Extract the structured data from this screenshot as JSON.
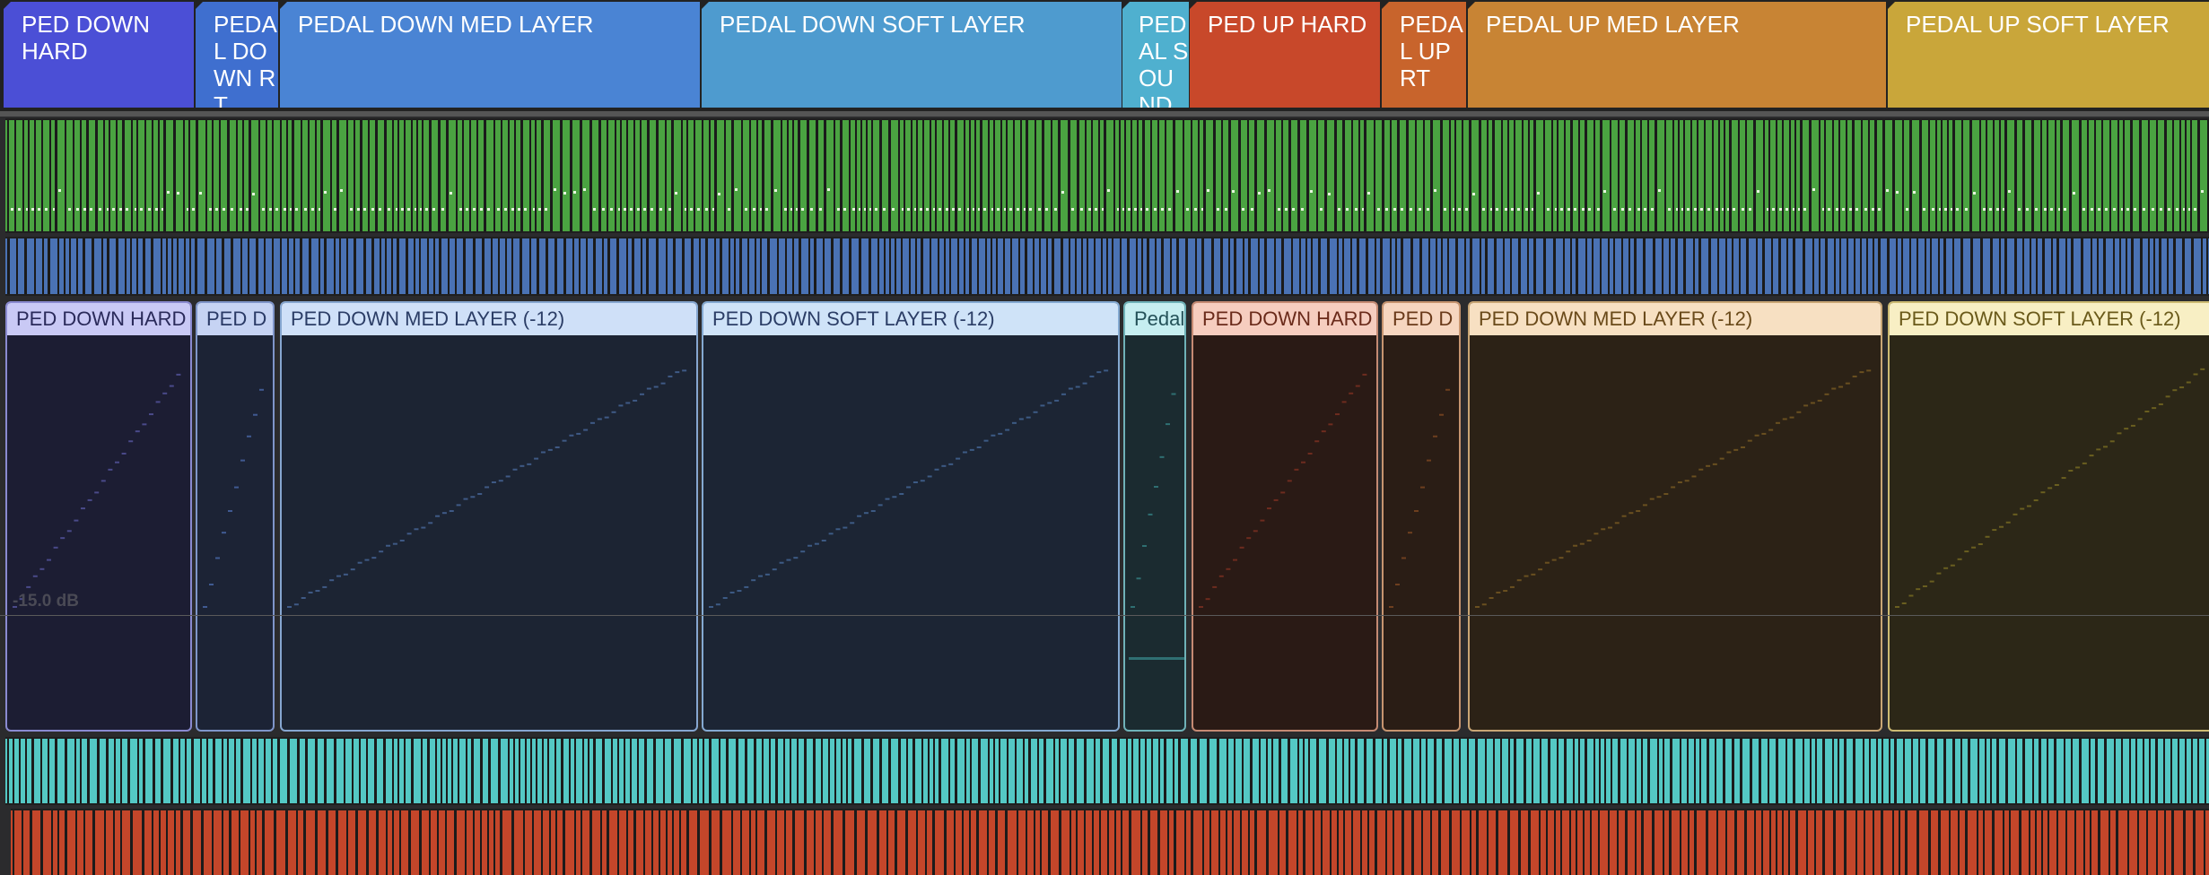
{
  "markers": [
    {
      "label": "PED DOWN HARD",
      "color": "#4b4fd6"
    },
    {
      "label": "PEDAL DOWN RT",
      "color": "#3f6fcf"
    },
    {
      "label": "PEDAL DOWN MED LAYER",
      "color": "#4a84d4"
    },
    {
      "label": "PEDAL DOWN SOFT LAYER",
      "color": "#4e9bcf"
    },
    {
      "label": "PEDAL SOUND",
      "color": "#4fb0cf"
    },
    {
      "label": "PED UP HARD",
      "color": "#c8482a"
    },
    {
      "label": "PEDAL UP RT",
      "color": "#c8642c"
    },
    {
      "label": "PEDAL UP MED LAYER",
      "color": "#c88434"
    },
    {
      "label": "PEDAL UP SOFT LAYER",
      "color": "#c9a63a"
    }
  ],
  "regions": [
    {
      "label": "PED DOWN HARD",
      "header_color": "#c9c9f5",
      "body_color": "#1c1d33",
      "border": "#8a8ad0",
      "text_color": "#2a2a5a",
      "line": "#4a4a8a"
    },
    {
      "label": "PED D",
      "header_color": "#c6d3f3",
      "body_color": "#1c2335",
      "border": "#7f95c9",
      "text_color": "#2a3a66",
      "line": "#405a92"
    },
    {
      "label": "PED DOWN MED LAYER (-12)",
      "header_color": "#cfe0f8",
      "body_color": "#1c2433",
      "border": "#86a6d0",
      "text_color": "#2b3d66",
      "line": "#3f5a86"
    },
    {
      "label": "PED DOWN SOFT LAYER (-12)",
      "header_color": "#cfe3f8",
      "body_color": "#1c2534",
      "border": "#84a9d1",
      "text_color": "#2b3d66",
      "line": "#3d5b85"
    },
    {
      "label": "Pedal",
      "header_color": "#c6eef0",
      "body_color": "#1b2b30",
      "border": "#6fb2b8",
      "text_color": "#245158",
      "line": "#2f6f72"
    },
    {
      "label": "PED DOWN HARD",
      "header_color": "#f6cdbf",
      "body_color": "#2a1a15",
      "border": "#c58a73",
      "text_color": "#6a2a1a",
      "line": "#6e2c1f"
    },
    {
      "label": "PED D",
      "header_color": "#f6d6c0",
      "body_color": "#2a1d15",
      "border": "#c6946f",
      "text_color": "#6a3a1a",
      "line": "#6e3f1f"
    },
    {
      "label": "PED DOWN MED LAYER (-12)",
      "header_color": "#f7e0c2",
      "body_color": "#2c2216",
      "border": "#c9a675",
      "text_color": "#6a4a1a",
      "line": "#6a5020"
    },
    {
      "label": "PED DOWN SOFT LAYER (-12)",
      "header_color": "#f8efc4",
      "body_color": "#2c2717",
      "border": "#cdbb73",
      "text_color": "#6a5a1a",
      "line": "#6a5f20"
    }
  ],
  "volume_label": "-15.0 dB"
}
